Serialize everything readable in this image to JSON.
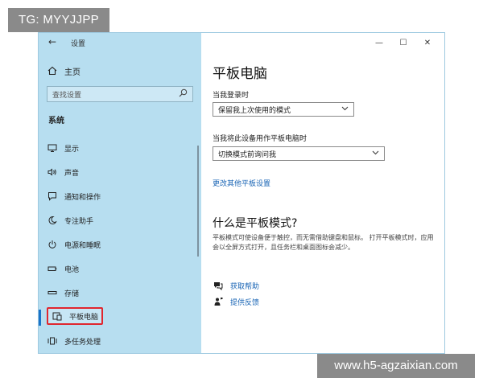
{
  "watermark_top": "TG: MYYJJPP",
  "watermark_bottom": "www.h5-agzaixian.com",
  "window": {
    "title": "设置",
    "controls": {
      "minimize": "—",
      "maximize": "☐",
      "close": "✕"
    }
  },
  "sidebar": {
    "home_label": "主页",
    "search_placeholder": "查找设置",
    "section_title": "系统",
    "items": [
      {
        "label": "显示",
        "icon": "monitor-icon"
      },
      {
        "label": "声音",
        "icon": "speaker-icon"
      },
      {
        "label": "通知和操作",
        "icon": "notification-icon"
      },
      {
        "label": "专注助手",
        "icon": "moon-icon"
      },
      {
        "label": "电源和睡眠",
        "icon": "power-icon"
      },
      {
        "label": "电池",
        "icon": "battery-icon"
      },
      {
        "label": "存储",
        "icon": "storage-icon"
      },
      {
        "label": "平板电脑",
        "icon": "tablet-icon",
        "selected": true
      },
      {
        "label": "多任务处理",
        "icon": "multitask-icon"
      }
    ]
  },
  "main": {
    "title": "平板电脑",
    "signin_label": "当我登录时",
    "signin_value": "保留我上次使用的模式",
    "tablet_label": "当我将此设备用作平板电脑时",
    "tablet_value": "切换模式前询问我",
    "more_link": "更改其他平板设置",
    "what_title": "什么是平板模式?",
    "what_desc": "平板模式可使设备便于触控，而无需借助键盘和鼠标。 打开平板模式时，应用会以全屏方式打开，且任务栏和桌面图标会减少。",
    "help_label": "获取帮助",
    "feedback_label": "提供反馈"
  },
  "colors": {
    "sidebar_bg": "#b7def0",
    "accent": "#1a74c9",
    "link": "#1a65b5",
    "highlight": "#e0262e"
  }
}
